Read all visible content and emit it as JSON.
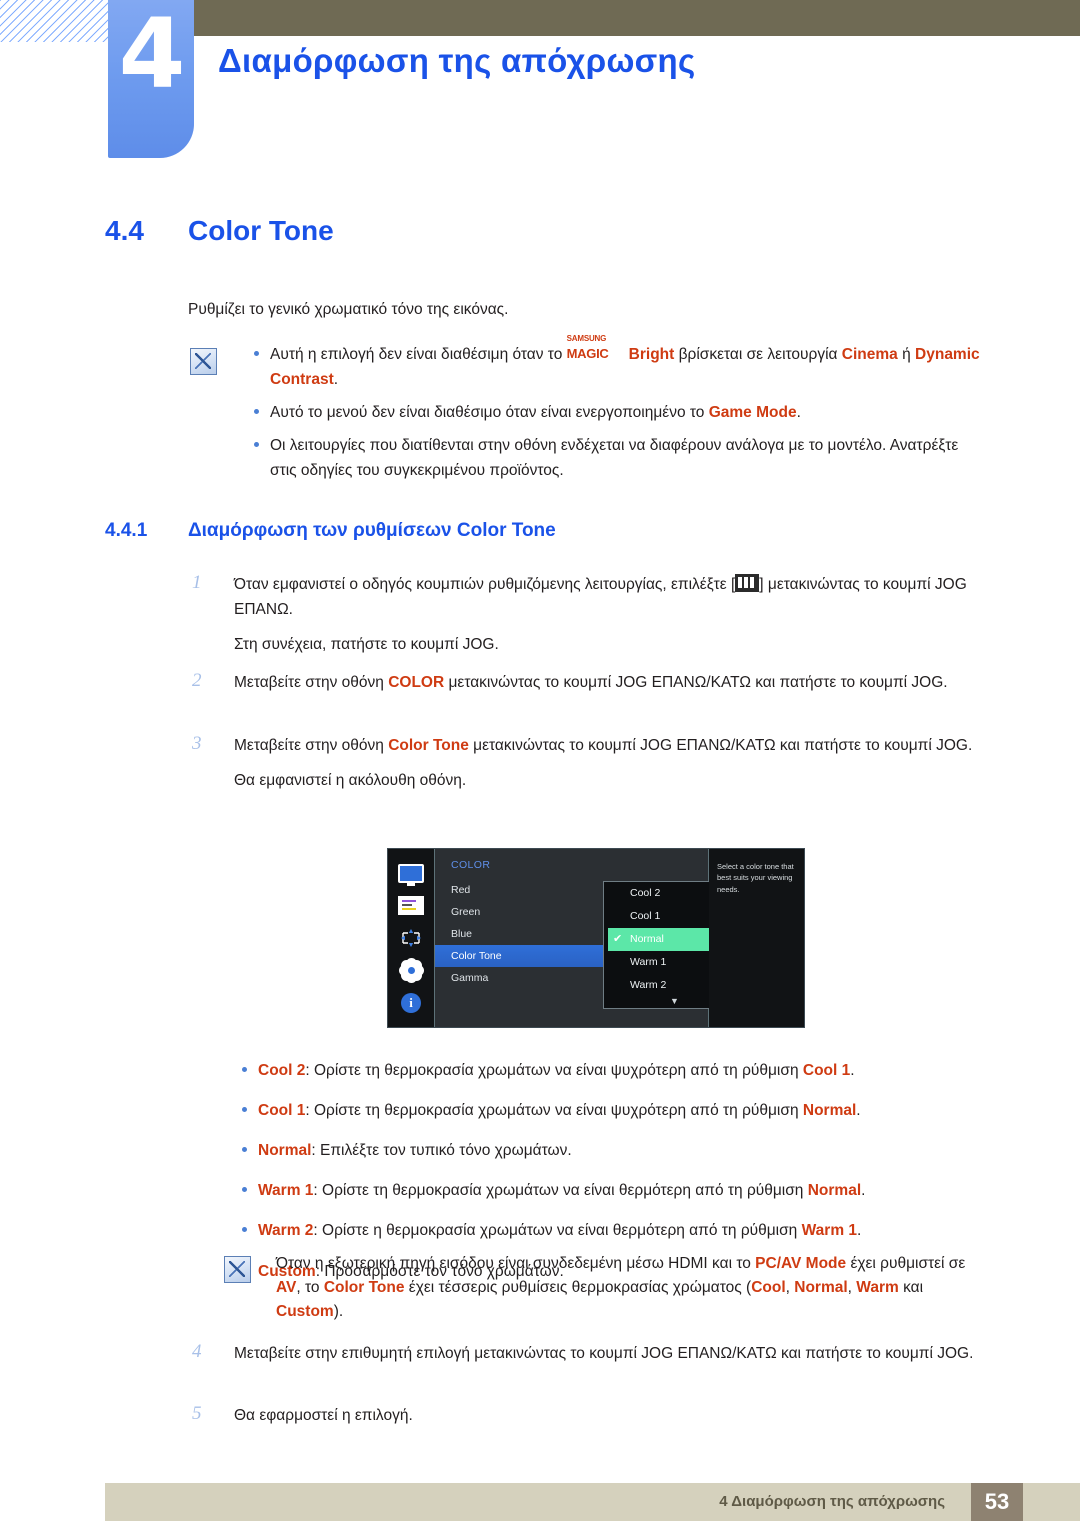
{
  "header": {
    "chapter_number": "4",
    "chapter_title": "Διαμόρφωση της απόχρωσης"
  },
  "section": {
    "number": "4.4",
    "title": "Color Tone",
    "intro": "Ρυθμίζει το γενικό χρωματικό τόνο της εικόνας."
  },
  "note_top": {
    "bullets": [
      {
        "pre": "Αυτή η επιλογή δεν είναι διαθέσιμη όταν το ",
        "magic_sup": "SAMSUNG",
        "magic_main": "MAGIC",
        "magic_bright": "Bright",
        "mid": " βρίσκεται σε λειτουργία ",
        "em1": "Cinema",
        "mid2": " ή ",
        "em2": "Dynamic Contrast",
        "post": "."
      },
      {
        "pre": "Αυτό το μενού δεν είναι διαθέσιμο όταν είναι ενεργοποιημένο το ",
        "em1": "Game Mode",
        "post": "."
      },
      {
        "pre": "Οι λειτουργίες που διατίθενται στην οθόνη ενδέχεται να διαφέρουν ανάλογα με το μοντέλο. Ανατρέξτε στις οδηγίες του συγκεκριμένου προϊόντος.",
        "post": ""
      }
    ]
  },
  "subsection": {
    "number": "4.4.1",
    "title": "Διαμόρφωση των ρυθμίσεων Color Tone"
  },
  "steps": [
    {
      "num": "1",
      "pre": "Όταν εμφανιστεί ο οδηγός κουμπιών ρυθμιζόμενης λειτουργίας, επιλέξτε [",
      "icon": "jog-menu-icon",
      "post": "] μετακινώντας το κουμπί JOG ΕΠΑΝΩ.",
      "subline": "Στη συνέχεια, πατήστε το κουμπί JOG."
    },
    {
      "num": "2",
      "pre": "Μεταβείτε στην οθόνη ",
      "em1": "COLOR",
      "post": " μετακινώντας το κουμπί JOG ΕΠΑΝΩ/ΚΑΤΩ και πατήστε το κουμπί JOG.",
      "subline": ""
    },
    {
      "num": "3",
      "pre": "Μεταβείτε στην οθόνη ",
      "em1": "Color Tone",
      "post": " μετακινώντας το κουμπί JOG ΕΠΑΝΩ/ΚΑΤΩ και πατήστε το κουμπί JOG.",
      "subline": "Θα εμφανιστεί η ακόλουθη οθόνη."
    },
    {
      "num": "4",
      "pre": "Μεταβείτε στην επιθυμητή επιλογή μετακινώντας το κουμπί JOG ΕΠΑΝΩ/ΚΑΤΩ και πατήστε το κουμπί JOG.",
      "em1": "",
      "post": "",
      "subline": ""
    },
    {
      "num": "5",
      "pre": "Θα εφαρμοστεί η επιλογή.",
      "em1": "",
      "post": "",
      "subline": ""
    }
  ],
  "osd": {
    "sidebar_icons": [
      "monitor-icon",
      "picture-icon",
      "move-icon",
      "gear-icon",
      "info-icon"
    ],
    "category": "COLOR",
    "items": [
      {
        "label": "Red",
        "selected": false
      },
      {
        "label": "Green",
        "selected": false
      },
      {
        "label": "Blue",
        "selected": false
      },
      {
        "label": "Color Tone",
        "selected": true
      },
      {
        "label": "Gamma",
        "selected": false
      }
    ],
    "options": [
      {
        "label": "Cool 2",
        "active": false
      },
      {
        "label": "Cool 1",
        "active": false
      },
      {
        "label": "Normal",
        "active": true
      },
      {
        "label": "Warm 1",
        "active": false
      },
      {
        "label": "Warm 2",
        "active": false
      }
    ],
    "scroll_arrow": "▼",
    "check_glyph": "✔",
    "description": "Select a color tone that best suits your viewing needs."
  },
  "option_list": [
    {
      "term": "Cool 2",
      "text": ": Ορίστε τη θερμοκρασία χρωμάτων να είναι ψυχρότερη από τη ρύθμιση ",
      "ref": "Cool 1",
      "tail": "."
    },
    {
      "term": "Cool 1",
      "text": ": Ορίστε τη θερμοκρασία χρωμάτων να είναι ψυχρότερη από τη ρύθμιση ",
      "ref": "Normal",
      "tail": "."
    },
    {
      "term": "Normal",
      "text": ": Επιλέξτε τον τυπικό τόνο χρωμάτων.",
      "ref": "",
      "tail": ""
    },
    {
      "term": "Warm 1",
      "text": ": Ορίστε τη θερμοκρασία χρωμάτων να είναι θερμότερη από τη ρύθμιση ",
      "ref": "Normal",
      "tail": "."
    },
    {
      "term": "Warm 2",
      "text": ": Ορίστε η θερμοκρασία χρωμάτων να είναι θερμότερη από τη ρύθμιση ",
      "ref": "Warm 1",
      "tail": "."
    },
    {
      "term": "Custom",
      "text": ": Προσαρμόστε τον τόνο χρωμάτων.",
      "ref": "",
      "tail": ""
    }
  ],
  "note_bottom": {
    "p1": "Όταν η εξωτερική πηγή εισόδου είναι συνδεδεμένη μέσω HDMI και το ",
    "e1": "PC/AV Mode",
    "p2": " έχει ρυθμιστεί σε ",
    "e2": "AV",
    "p3": ", το ",
    "e3": "Color Tone",
    "p4": " έχει τέσσερις ρυθμίσεις θερμοκρασίας χρώματος (",
    "e4": "Cool",
    "p5": ", ",
    "e5": "Normal",
    "p6": ", ",
    "e6": "Warm",
    "p7": " και ",
    "e7": "Custom",
    "p8": ")."
  },
  "footer": {
    "text": "4 Διαμόρφωση της απόχρωσης",
    "page": "53"
  },
  "colors": {
    "heading_blue": "#1a52e8",
    "accent_red": "#cf3b12",
    "header_bar": "#6f6a54",
    "footer_bar": "#d5d1bd",
    "page_badge": "#8e8271"
  }
}
